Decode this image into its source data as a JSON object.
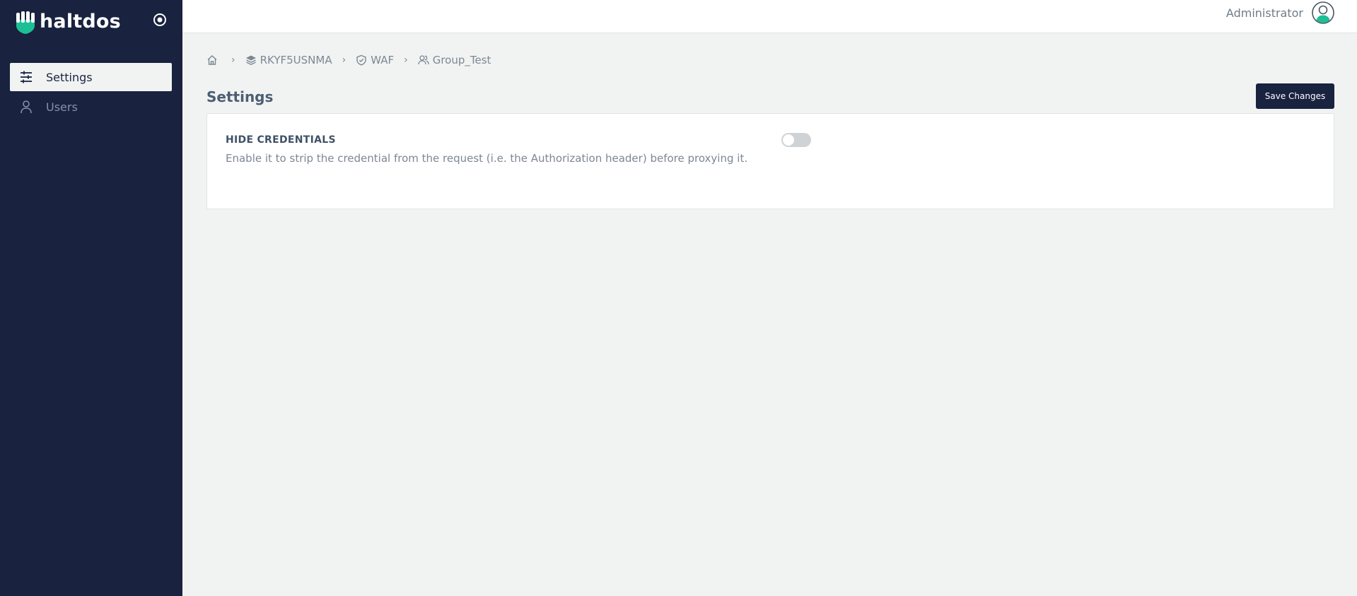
{
  "brand": {
    "name": "haltdos",
    "accent": "#1dbf95"
  },
  "sidebar": {
    "items": [
      {
        "label": "Settings",
        "icon": "sliders-icon",
        "active": true
      },
      {
        "label": "Users",
        "icon": "user-icon",
        "active": false
      }
    ]
  },
  "header": {
    "user_name": "Administrator"
  },
  "breadcrumb": {
    "items": [
      {
        "label": "",
        "icon": "home-icon"
      },
      {
        "label": "RKYF5USNMA",
        "icon": "layers-icon"
      },
      {
        "label": "WAF",
        "icon": "shield-icon"
      },
      {
        "label": "Group_Test",
        "icon": "users-icon"
      }
    ],
    "separator": "›"
  },
  "page": {
    "title": "Settings",
    "save_label": "Save Changes"
  },
  "settings": {
    "hide_credentials": {
      "title": "HIDE CREDENTIALS",
      "description": "Enable it to strip the credential from the request (i.e. the Authorization header) before proxying it.",
      "enabled": false
    }
  }
}
